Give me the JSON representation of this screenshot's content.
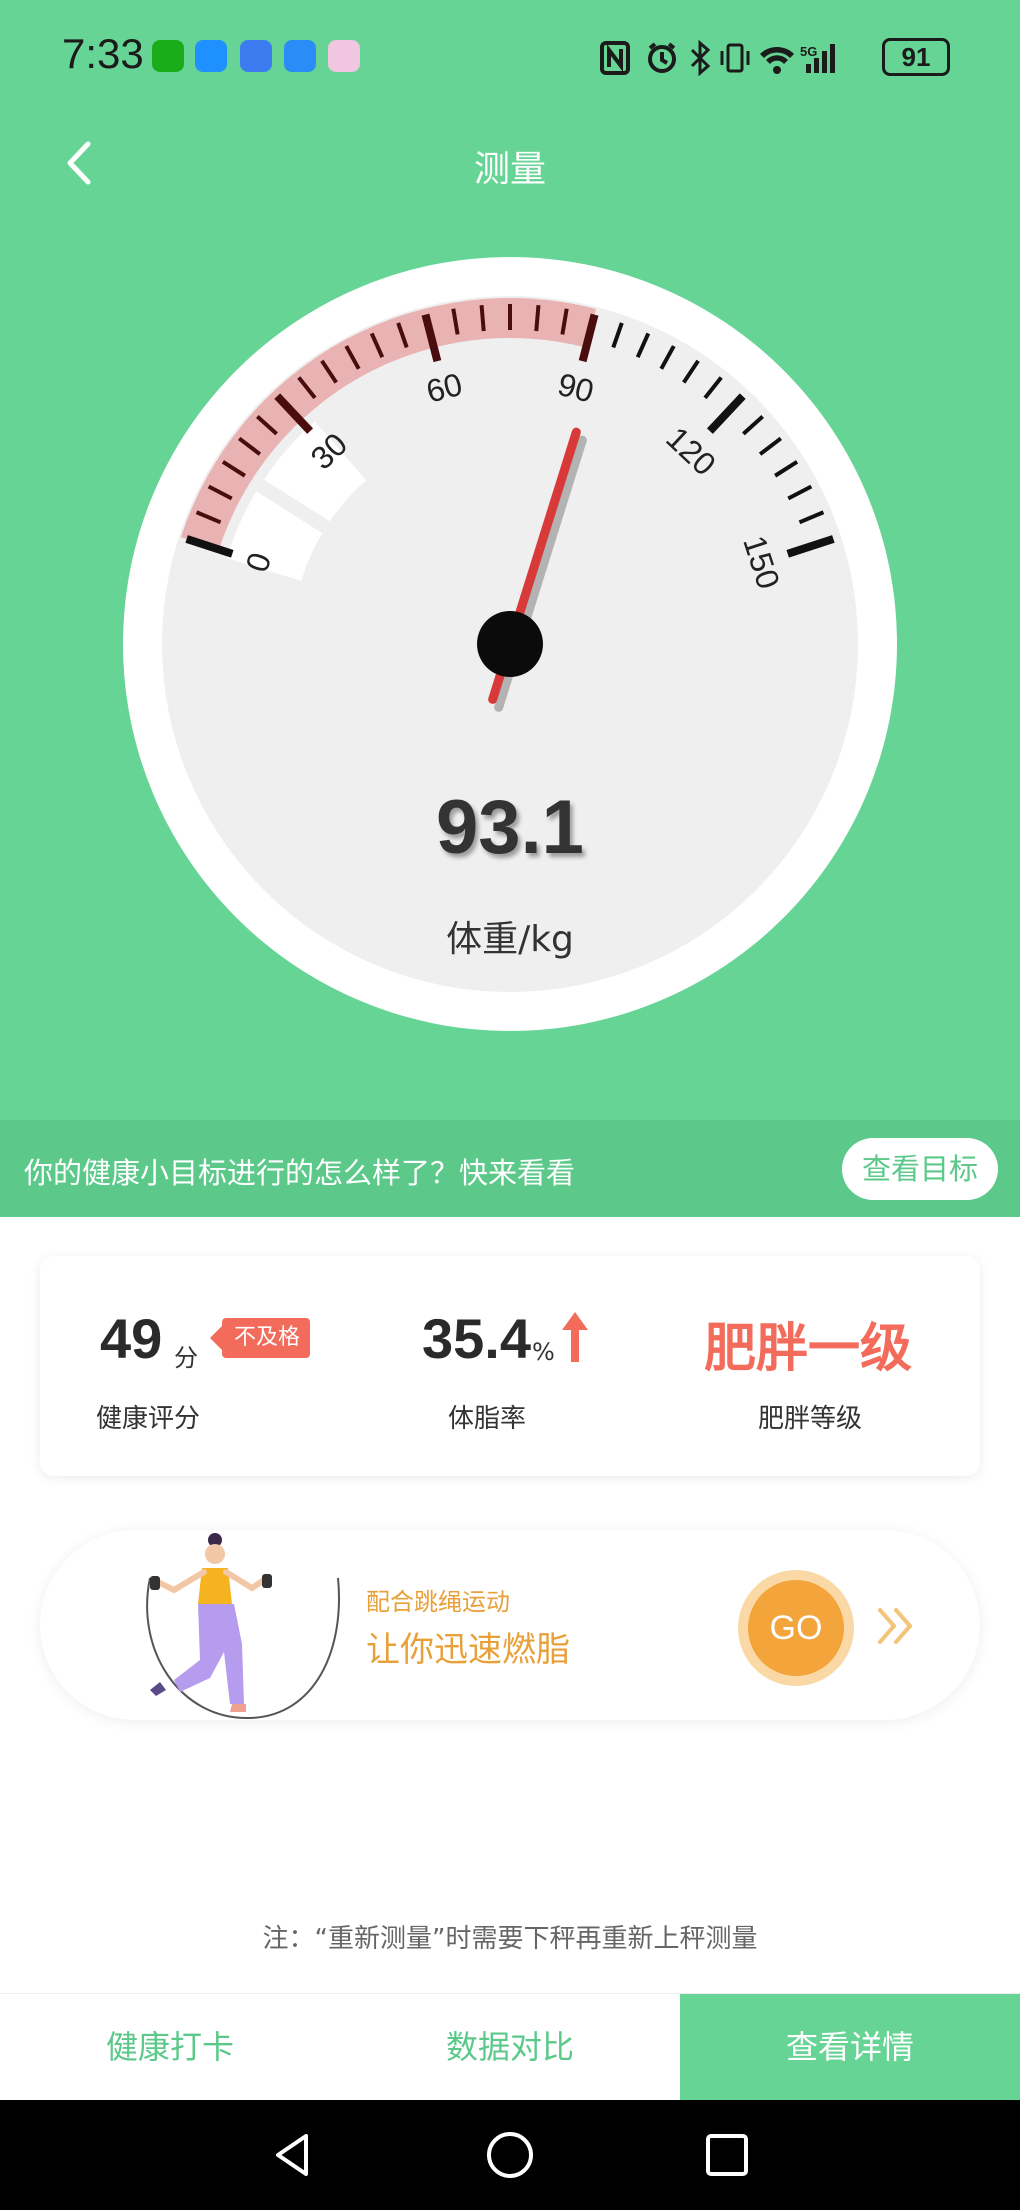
{
  "status_bar": {
    "time": "7:33",
    "battery": "91",
    "icons": [
      "nfc-icon",
      "alarm-icon",
      "bluetooth-icon",
      "vibrate-icon",
      "wifi-icon",
      "5g-signal-icon",
      "battery-icon"
    ],
    "app_icons": [
      "wechat-icon",
      "message-icon",
      "app-icon",
      "feishu-icon",
      "photos-icon"
    ]
  },
  "header": {
    "title": "测量",
    "back_icon": "chevron-left-icon"
  },
  "gauge": {
    "value": "93.1",
    "value_number": 93.1,
    "unit_label": "体重/kg",
    "min": 0,
    "max": 150,
    "tick_labels": [
      "0",
      "30",
      "60",
      "90",
      "120",
      "150"
    ],
    "highlight_range": [
      0,
      90
    ],
    "colors": {
      "highlight": "#e9b3b3",
      "needle": "#d83a3a",
      "face": "#efefef",
      "rim": "#ffffff"
    }
  },
  "banner": {
    "text": "你的健康小目标进行的怎么样了？快来看看",
    "button": "查看目标"
  },
  "stats": {
    "score": {
      "value": "49",
      "unit": "分",
      "badge": "不及格",
      "label": "健康评分"
    },
    "body_fat": {
      "value": "35.4",
      "unit": "%",
      "trend_icon": "arrow-up-icon",
      "label": "体脂率"
    },
    "obesity": {
      "value": "肥胖一级",
      "label": "肥胖等级"
    }
  },
  "jump_rope": {
    "subtitle": "配合跳绳运动",
    "title": "让你迅速燃脂",
    "go": "GO",
    "illustration": "girl-jumping-rope-illustration"
  },
  "note": "注：“重新测量”时需要下秤再重新上秤测量",
  "tabs": [
    {
      "label": "健康打卡",
      "active": false
    },
    {
      "label": "数据对比",
      "active": false
    },
    {
      "label": "查看详情",
      "active": true
    }
  ],
  "nav": {
    "icons": [
      "back-triangle-icon",
      "home-circle-icon",
      "recents-square-icon"
    ]
  },
  "colors": {
    "primary_green": "#66d494",
    "accent_red": "#f26b5b",
    "accent_orange": "#f3a43b"
  }
}
